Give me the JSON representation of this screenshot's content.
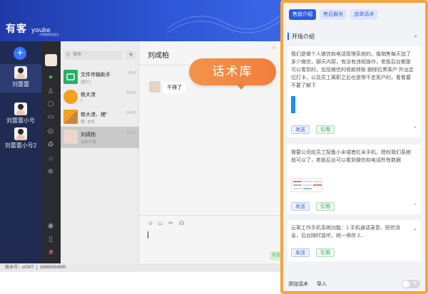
{
  "app": {
    "logo_text": "有客",
    "logo_sub": "youke",
    "tagline": "为销售提效而生",
    "version_label": "版本号：v0307",
    "phone": "18668364885"
  },
  "accounts": {
    "add_label": "+",
    "items": [
      {
        "name": "刘蕾蕾"
      },
      {
        "name": "刘蕾蕾小号"
      },
      {
        "name": "刘蕾蕾小号2"
      }
    ]
  },
  "conversations": {
    "search_placeholder": "搜索",
    "items": [
      {
        "name": "文件传输助手",
        "sub": "[图片]",
        "time": "08:5"
      },
      {
        "name": "轶大渣",
        "sub": "1",
        "time": "24/07"
      },
      {
        "name": "轶大渣、猪\"",
        "sub": "猪\" 老鸭",
        "time": "24/07"
      },
      {
        "name": "刘成柏",
        "sub": "留款不要",
        "time": "10:38"
      }
    ]
  },
  "chat": {
    "title": "刘成柏",
    "message": "不得了",
    "send_label": "发送"
  },
  "overlay": {
    "badge_text": "话术库"
  },
  "panel": {
    "tabs": [
      {
        "label": "售前介绍",
        "active": true
      },
      {
        "label": "售后服务",
        "active": false
      },
      {
        "label": "追单话术",
        "active": false
      }
    ],
    "section_title": "开场介绍",
    "cards": [
      {
        "text": "我们是做个人微信和电话管理系统的，像销售每天加了多少微信，聊天内容，有没有违规操作，老板后台都是可以看到的，包括微信的收款转账 删除拉黑客户 外出定位打卡，以及员工离职之后也是带不走客户的，看看要不要了解下"
      },
      {
        "text": "需要公司给员工配备小米或者红米手机，授权我们系统就可以了，老板后台可以看到微信和电话所有数据"
      },
      {
        "text": "云客工作手机系统功能：1.手机通话录音、短信消息，后台随时监听，统一保存 2..."
      }
    ],
    "send_btn": "发送",
    "quote_btn": "引用",
    "add_script": "添加话术",
    "import": "导入",
    "toggle_label": "关"
  },
  "colors": {
    "brand_blue": "#2f5be0",
    "accent_orange": "#f5a53d",
    "wechat_green": "#2ec26a"
  }
}
